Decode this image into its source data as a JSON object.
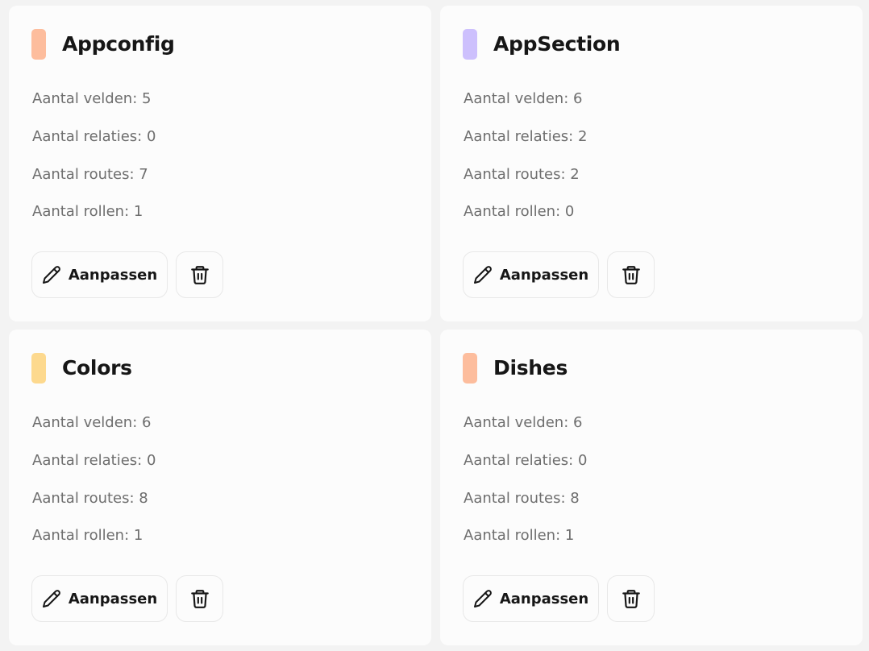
{
  "cards": [
    {
      "title": "Appconfig",
      "color": "#fdbd9d",
      "stats": [
        "Aantal velden: 5",
        "Aantal relaties: 0",
        "Aantal routes: 7",
        "Aantal rollen: 1"
      ],
      "edit_label": "Aanpassen"
    },
    {
      "title": "AppSection",
      "color": "#cdc0fd",
      "stats": [
        "Aantal velden: 6",
        "Aantal relaties: 2",
        "Aantal routes: 2",
        "Aantal rollen: 0"
      ],
      "edit_label": "Aanpassen"
    },
    {
      "title": "Colors",
      "color": "#fdd98e",
      "stats": [
        "Aantal velden: 6",
        "Aantal relaties: 0",
        "Aantal routes: 8",
        "Aantal rollen: 1"
      ],
      "edit_label": "Aanpassen"
    },
    {
      "title": "Dishes",
      "color": "#fdbd9d",
      "stats": [
        "Aantal velden: 6",
        "Aantal relaties: 0",
        "Aantal routes: 8",
        "Aantal rollen: 1"
      ],
      "edit_label": "Aanpassen"
    }
  ],
  "icons": {
    "edit": "pencil-icon",
    "delete": "trash-icon"
  }
}
